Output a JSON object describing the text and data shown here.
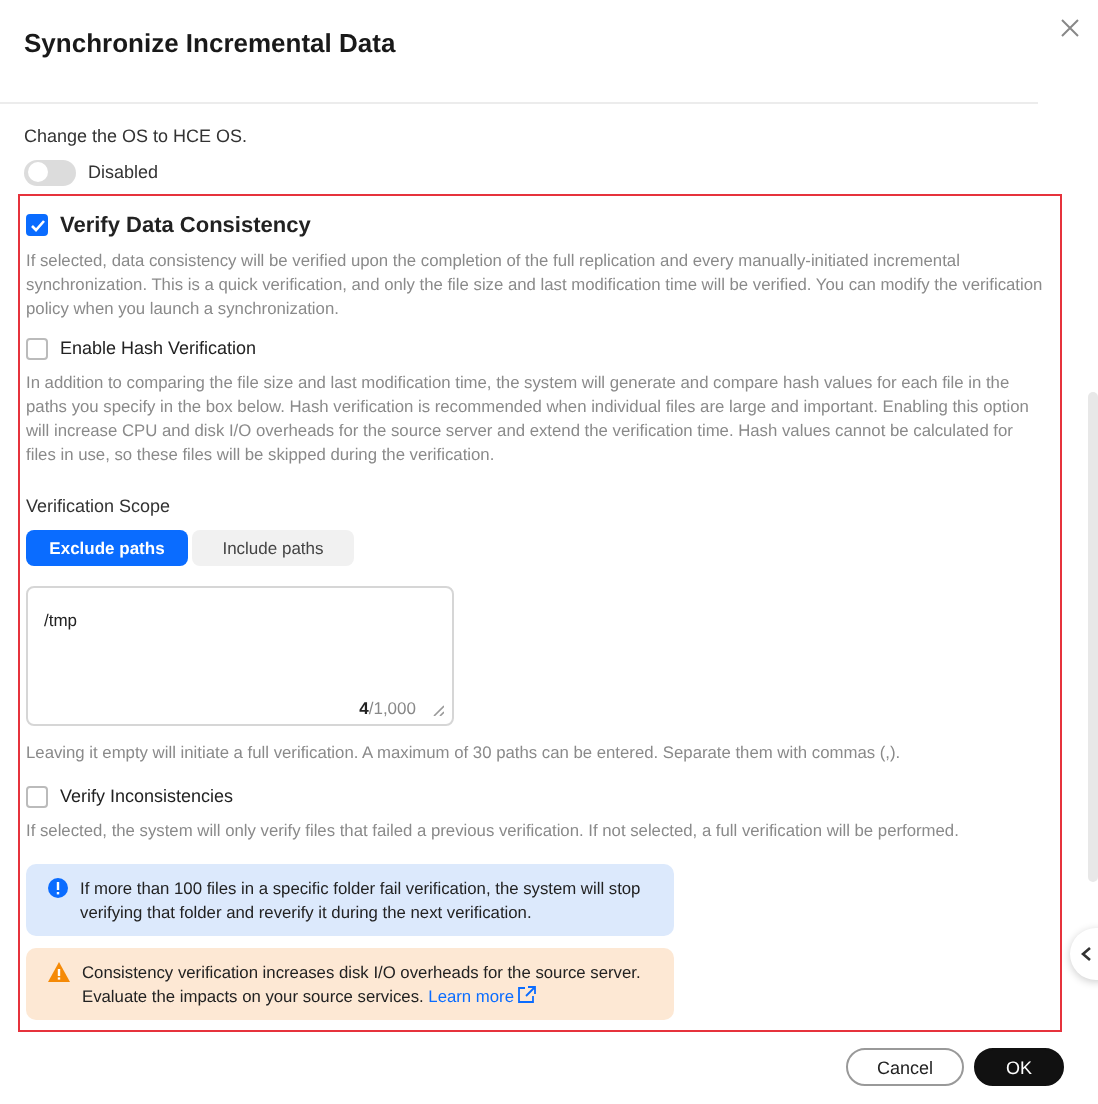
{
  "dialog": {
    "title": "Synchronize Incremental Data"
  },
  "os_change": {
    "label": "Change the OS to HCE OS.",
    "toggle": {
      "on": false,
      "label": "Disabled"
    }
  },
  "verify_consistency": {
    "checked": true,
    "label": "Verify Data Consistency",
    "description": "If selected, data consistency will be verified upon the completion of the full replication and every manually-initiated incremental synchronization. This is a quick verification, and only the file size and last modification time will be verified. You can modify the verification policy when you launch a synchronization."
  },
  "hash_verification": {
    "checked": false,
    "label": "Enable Hash Verification",
    "description": "In addition to comparing the file size and last modification time, the system will generate and compare hash values for each file in the paths you specify in the box below. Hash verification is recommended when individual files are large and important. Enabling this option will increase CPU and disk I/O overheads for the source server and extend the verification time. Hash values cannot be calculated for files in use, so these files will be skipped during the verification."
  },
  "scope": {
    "label": "Verification Scope",
    "tabs": [
      {
        "label": "Exclude paths",
        "selected": true
      },
      {
        "label": "Include paths",
        "selected": false
      }
    ],
    "paths": {
      "value": "/tmp",
      "counter": "**4**/1,000"
    },
    "hint": "Leaving it empty will initiate a full verification. A maximum of 30 paths can be entered. Separate them with commas (,)."
  },
  "verify_inconsistencies": {
    "checked": false,
    "label": "Verify Inconsistencies",
    "description": "If selected, the system will only verify files that failed a previous verification. If not selected, a full verification will be performed."
  },
  "alerts": [
    {
      "kind": "info",
      "text": "If more than 100 files in a specific folder fail verification, the system will stop verifying that folder and reverify it during the next verification."
    },
    {
      "kind": "warning",
      "text": "Consistency verification increases disk I/O overheads for the source server. Evaluate the impacts on your source services.",
      "link": "Learn more"
    }
  ],
  "buttons": [
    {
      "label": "Cancel",
      "kind": "secondary"
    },
    {
      "label": "OK",
      "kind": "primary"
    }
  ]
}
